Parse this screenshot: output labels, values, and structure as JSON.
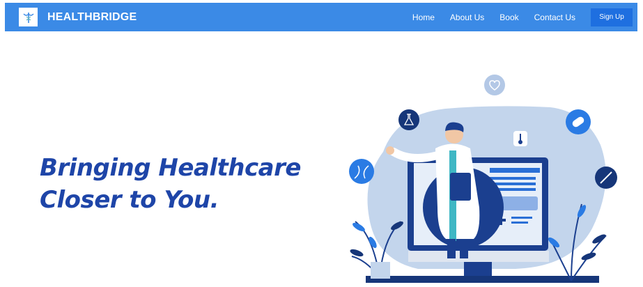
{
  "brand": {
    "name": "HEALTHBRIDGE",
    "logo_icon": "caduceus-icon"
  },
  "nav": {
    "links": [
      "Home",
      "About Us",
      "Book",
      "Contact Us"
    ],
    "signup_label": "Sign Up"
  },
  "hero": {
    "title_line1": "Bringing Healthcare",
    "title_line2": "Closer to You."
  },
  "colors": {
    "navbar": "#3b8ae6",
    "signup": "#1e6fe0",
    "title": "#1e45a8",
    "illustration_dark": "#1b3f8f",
    "illustration_light": "#c3d5ec"
  }
}
